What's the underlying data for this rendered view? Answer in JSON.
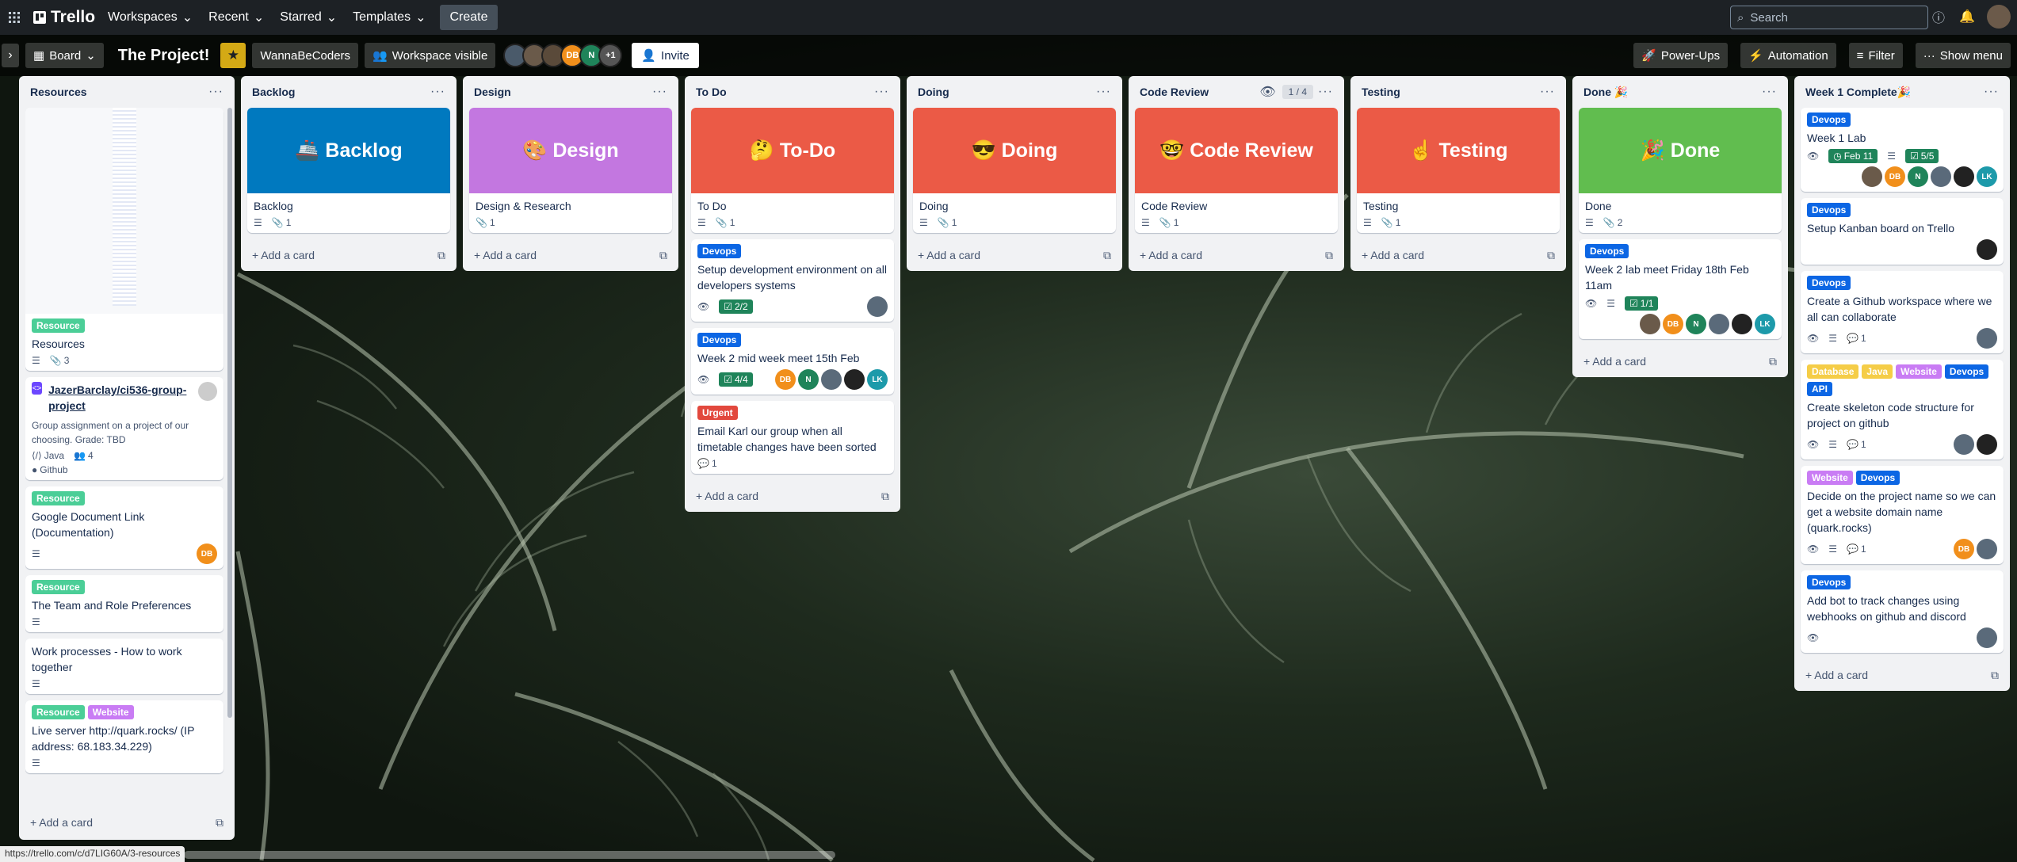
{
  "nav": {
    "logo": "Trello",
    "menus": [
      "Workspaces",
      "Recent",
      "Starred",
      "Templates"
    ],
    "create": "Create",
    "search_placeholder": "Search"
  },
  "board": {
    "view": "Board",
    "title": "The Project!",
    "workspace": "WannaBeCoders",
    "visibility": "Workspace visible",
    "members": [
      {
        "initials": "",
        "color": "#4a5a6a"
      },
      {
        "initials": "",
        "color": "#6a5a4a"
      },
      {
        "initials": "",
        "color": "#5a4a3a"
      },
      {
        "initials": "DB",
        "color": "#f18f1b"
      },
      {
        "initials": "N",
        "color": "#1f845a"
      }
    ],
    "more_members": "+1",
    "invite": "Invite",
    "powerups": "Power-Ups",
    "automation": "Automation",
    "filter": "Filter",
    "show_menu": "Show menu"
  },
  "colors": {
    "devops": "#0c66e4",
    "resource": "#4bce97",
    "website": "#c97cf4",
    "java": "#f5cd47",
    "database": "#f5cd47",
    "api": "#0c66e4",
    "urgent": "#e2483d",
    "backlog_cover": "#0079bf",
    "design_cover": "#c377e0",
    "red_cover": "#eb5a46",
    "done_cover": "#61bd4f"
  },
  "lists": {
    "resources": {
      "title": "Resources",
      "card1": {
        "label": "Resource",
        "title": "Resources",
        "attachments": "3"
      },
      "card2": {
        "repo": "JazerBarclay/ci536-group-project",
        "desc": "Group assignment on a project of our choosing. Grade: TBD",
        "lang": "Java",
        "contributors": "4",
        "source": "Github"
      },
      "card3": {
        "label": "Resource",
        "title": "Google Document Link (Documentation)",
        "member": "DB"
      },
      "card4": {
        "label": "Resource",
        "title": "The Team and Role Preferences"
      },
      "card5": {
        "title": "Work processes - How to work together"
      },
      "card6": {
        "labels": [
          "Resource",
          "Website"
        ],
        "title": "Live server http://quark.rocks/ (IP address: 68.183.34.229)"
      },
      "add": "Add a card"
    },
    "backlog": {
      "title": "Backlog",
      "cover": "🚢 Backlog",
      "card": "Backlog",
      "attachments": "1",
      "add": "Add a card"
    },
    "design": {
      "title": "Design",
      "cover": "🎨 Design",
      "card": "Design & Research",
      "attachments": "1",
      "add": "Add a card"
    },
    "todo": {
      "title": "To Do",
      "cover": "🤔 To-Do",
      "card": "To Do",
      "attachments": "1",
      "card2": {
        "label": "Devops",
        "title": "Setup development environment on all developers systems",
        "check": "2/2"
      },
      "card3": {
        "label": "Devops",
        "title": "Week 2 mid week meet 15th Feb",
        "check": "4/4",
        "m1": "DB",
        "m2": "N",
        "m5": "LK"
      },
      "card4": {
        "label": "Urgent",
        "title": "Email Karl our group when all timetable changes have been sorted",
        "comments": "1"
      },
      "add": "Add a card"
    },
    "doing": {
      "title": "Doing",
      "cover": "😎 Doing",
      "card": "Doing",
      "attachments": "1",
      "add": "Add a card"
    },
    "review": {
      "title": "Code Review",
      "count": "1 / 4",
      "cover": "🤓 Code Review",
      "card": "Code Review",
      "attachments": "1",
      "add": "Add a card"
    },
    "testing": {
      "title": "Testing",
      "cover": "☝️ Testing",
      "card": "Testing",
      "attachments": "1",
      "add": "Add a card"
    },
    "done": {
      "title": "Done 🎉",
      "cover": "🎉 Done",
      "card": "Done",
      "attachments": "2",
      "card2": {
        "label": "Devops",
        "title": "Week 2 lab meet Friday 18th Feb 11am",
        "check": "1/1",
        "m2": "DB",
        "m3": "N",
        "m5": "LK"
      },
      "add": "Add a card"
    },
    "week1": {
      "title": "Week 1 Complete🎉",
      "card1": {
        "label": "Devops",
        "title": "Week 1 Lab",
        "date": "Feb 11",
        "check": "5/5",
        "m2": "DB",
        "m3": "N",
        "m6": "LK"
      },
      "card2": {
        "label": "Devops",
        "title": "Setup Kanban board on Trello"
      },
      "card3": {
        "label": "Devops",
        "title": "Create a Github workspace where we all can collaborate",
        "comments": "1"
      },
      "card4": {
        "labels": [
          "Database",
          "Java",
          "Website",
          "Devops",
          "API"
        ],
        "title": "Create skeleton code structure for project on github",
        "comments": "1"
      },
      "card5": {
        "labels": [
          "Website",
          "Devops"
        ],
        "title": "Decide on the project name so we can get a website domain name (quark.rocks)",
        "comments": "1",
        "member": "DB"
      },
      "card6": {
        "label": "Devops",
        "title": "Add bot to track changes using webhooks on github and discord"
      },
      "add": "Add a card"
    }
  },
  "status_url": "https://trello.com/c/d7LIG60A/3-resources"
}
